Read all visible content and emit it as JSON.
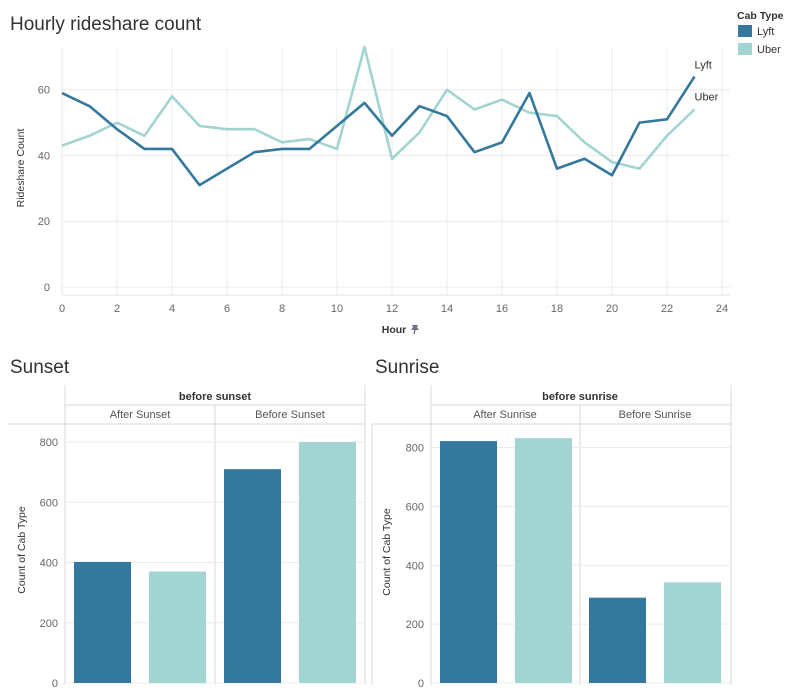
{
  "colors": {
    "lyft": "#34799d",
    "uber": "#a2d5d2",
    "grid": "#ececec",
    "axis": "#cccccc"
  },
  "legend": {
    "title": "Cab Type",
    "items": [
      {
        "label": "Lyft",
        "color": "#34799d"
      },
      {
        "label": "Uber",
        "color": "#a2d5d2"
      }
    ]
  },
  "chart_data": [
    {
      "type": "line",
      "title": "Hourly rideshare count",
      "xlabel": "Hour",
      "ylabel": "Rideshare Count",
      "xlim": [
        0,
        24
      ],
      "ylim": [
        0,
        73
      ],
      "xticks": [
        "0",
        "2",
        "4",
        "6",
        "8",
        "10",
        "12",
        "14",
        "16",
        "18",
        "20",
        "22",
        "24"
      ],
      "yticks": [
        "0",
        "20",
        "40",
        "60"
      ],
      "grid": true,
      "legend_position": "top-right",
      "x": [
        0,
        1,
        2,
        3,
        4,
        5,
        6,
        7,
        8,
        9,
        10,
        11,
        12,
        13,
        14,
        15,
        16,
        17,
        18,
        19,
        20,
        21,
        22,
        23
      ],
      "series": [
        {
          "name": "Lyft",
          "color": "#34799d",
          "end_label": "Lyft",
          "values": [
            59,
            55,
            48,
            42,
            42,
            31,
            36,
            41,
            42,
            42,
            49,
            56,
            46,
            55,
            52,
            41,
            44,
            59,
            36,
            39,
            34,
            50,
            51,
            64
          ]
        },
        {
          "name": "Uber",
          "color": "#a2d5d2",
          "end_label": "Uber",
          "values": [
            43,
            46,
            50,
            46,
            58,
            49,
            48,
            48,
            44,
            45,
            42,
            73,
            39,
            47,
            60,
            54,
            57,
            53,
            52,
            44,
            38,
            36,
            46,
            54
          ]
        }
      ]
    },
    {
      "type": "bar",
      "title": "Sunset",
      "facet_title": "before sunset",
      "ylabel": "Count of Cab Type",
      "ylim": [
        0,
        860
      ],
      "yticks": [
        "0",
        "200",
        "400",
        "600",
        "800"
      ],
      "categories": [
        "After Sunset",
        "Before Sunset"
      ],
      "series": [
        {
          "name": "Lyft",
          "values": [
            402,
            710
          ]
        },
        {
          "name": "Uber",
          "values": [
            370,
            800
          ]
        }
      ]
    },
    {
      "type": "bar",
      "title": "Sunrise",
      "facet_title": "before sunrise",
      "ylabel": "Count of Cab Type",
      "ylim": [
        0,
        880
      ],
      "yticks": [
        "0",
        "200",
        "400",
        "600",
        "800"
      ],
      "categories": [
        "After Sunrise",
        "Before Sunrise"
      ],
      "series": [
        {
          "name": "Lyft",
          "values": [
            822,
            290
          ]
        },
        {
          "name": "Uber",
          "values": [
            832,
            342
          ]
        }
      ]
    }
  ]
}
